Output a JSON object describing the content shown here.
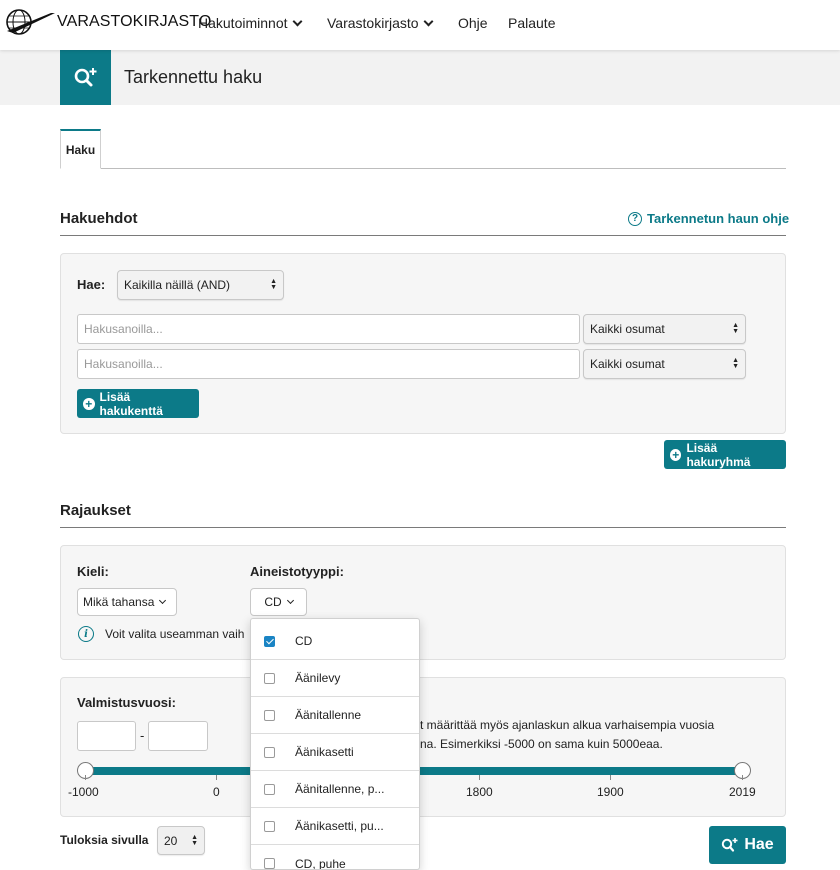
{
  "header": {
    "logo_text": "VARASTOKIRJASTO",
    "nav": [
      {
        "label": "Hakutoiminnot",
        "has_menu": true
      },
      {
        "label": "Varastokirjasto",
        "has_menu": true
      },
      {
        "label": "Ohje",
        "has_menu": false
      },
      {
        "label": "Palaute",
        "has_menu": false
      }
    ]
  },
  "page": {
    "title": "Tarkennettu haku",
    "tab_label": "Haku"
  },
  "search": {
    "heading": "Hakuehdot",
    "help_link": "Tarkennetun haun ohje",
    "match_label": "Hae:",
    "match_value": "Kaikilla näillä (AND)",
    "fields": [
      {
        "placeholder": "Hakusanoilla...",
        "type_value": "Kaikki osumat"
      },
      {
        "placeholder": "Hakusanoilla...",
        "type_value": "Kaikki osumat"
      }
    ],
    "add_field_label": "Lisää hakukenttä",
    "add_group_label": "Lisää hakuryhmä"
  },
  "limits": {
    "heading": "Rajaukset",
    "language_label": "Kieli:",
    "language_value": "Mikä tahansa",
    "format_label": "Aineistotyyppi:",
    "format_value": "CD",
    "info_text": "Voit valita useamman vaih",
    "year_label": "Valmistusvuosi:",
    "year_sep": "-",
    "year_info_line1": "t määrittää myös ajanlaskun alkua varhaisempia vuosia",
    "year_info_line2": "na. Esimerkiksi -5000 on sama kuin 5000eaa.",
    "slider_ticks": [
      "-1000",
      "0",
      "1800",
      "1900",
      "2019"
    ]
  },
  "format_options": [
    {
      "label": "CD",
      "checked": true
    },
    {
      "label": "Äänilevy",
      "checked": false
    },
    {
      "label": "Äänitallenne",
      "checked": false
    },
    {
      "label": "Äänikasetti",
      "checked": false
    },
    {
      "label": "Äänitallenne, p...",
      "checked": false
    },
    {
      "label": "Äänikasetti, pu...",
      "checked": false
    },
    {
      "label": "CD, puhe",
      "checked": false
    }
  ],
  "footer": {
    "per_page_label": "Tuloksia sivulla",
    "per_page_value": "20",
    "search_button": "Hae"
  },
  "colors": {
    "accent": "#0c7a88",
    "checkbox": "#1a84c4"
  }
}
